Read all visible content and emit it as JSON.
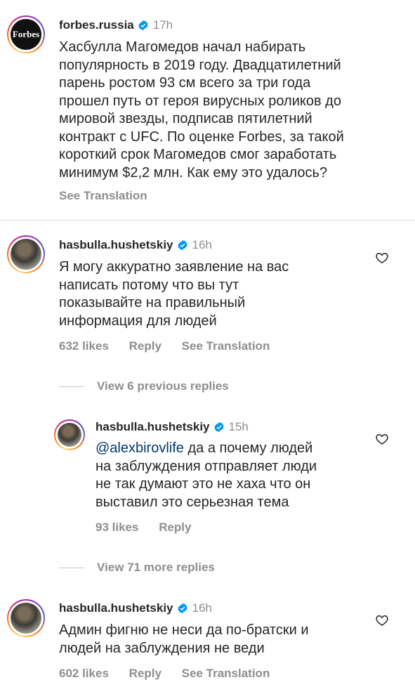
{
  "post": {
    "username": "forbes.russia",
    "time": "17h",
    "avatar_text": "Forbes",
    "text": "Хасбулла Магомедов начал набирать\nпопулярность в 2019 году. Двадцатилетний\nпарень ростом 93 см всего за три года\nпрошел путь от героя вирусных роликов до\nмировой звезды, подписав пятилетний\nконтракт с UFC. По оценке Forbes, за такой\nкороткий срок Магомедов смог заработать\nминимум $2,2 млн. Как ему это удалось?",
    "see_translation": "See Translation"
  },
  "comments": [
    {
      "username": "hasbulla.hushetskiy",
      "time": "16h",
      "text": "Я могу аккуратно заявление на вас\nнаписать потому что вы тут\nпоказывайте на правильный\nинформация для людей",
      "likes": "632 likes",
      "reply": "Reply",
      "see_translation": "See Translation"
    },
    {
      "username": "hasbulla.hushetskiy",
      "time": "15h",
      "mention": "@alexbirovlife",
      "text": " да а почему людей\nна заблуждения отправляет люди\nне так думают это не хаха что он\nвыставил это серьезная тема",
      "likes": "93 likes",
      "reply": "Reply"
    },
    {
      "username": "hasbulla.hushetskiy",
      "time": "16h",
      "text": "Админ фигню не неси да по-братски и\nлюдей на заблуждения не веди",
      "likes": "602 likes",
      "reply": "Reply",
      "see_translation": "See Translation"
    }
  ],
  "view_previous": "View 6 previous replies",
  "view_more": "View 71 more replies",
  "colors": {
    "text": "#262626",
    "secondary": "#8e8e8e",
    "verified": "#0095f6",
    "mention": "#00376b"
  }
}
